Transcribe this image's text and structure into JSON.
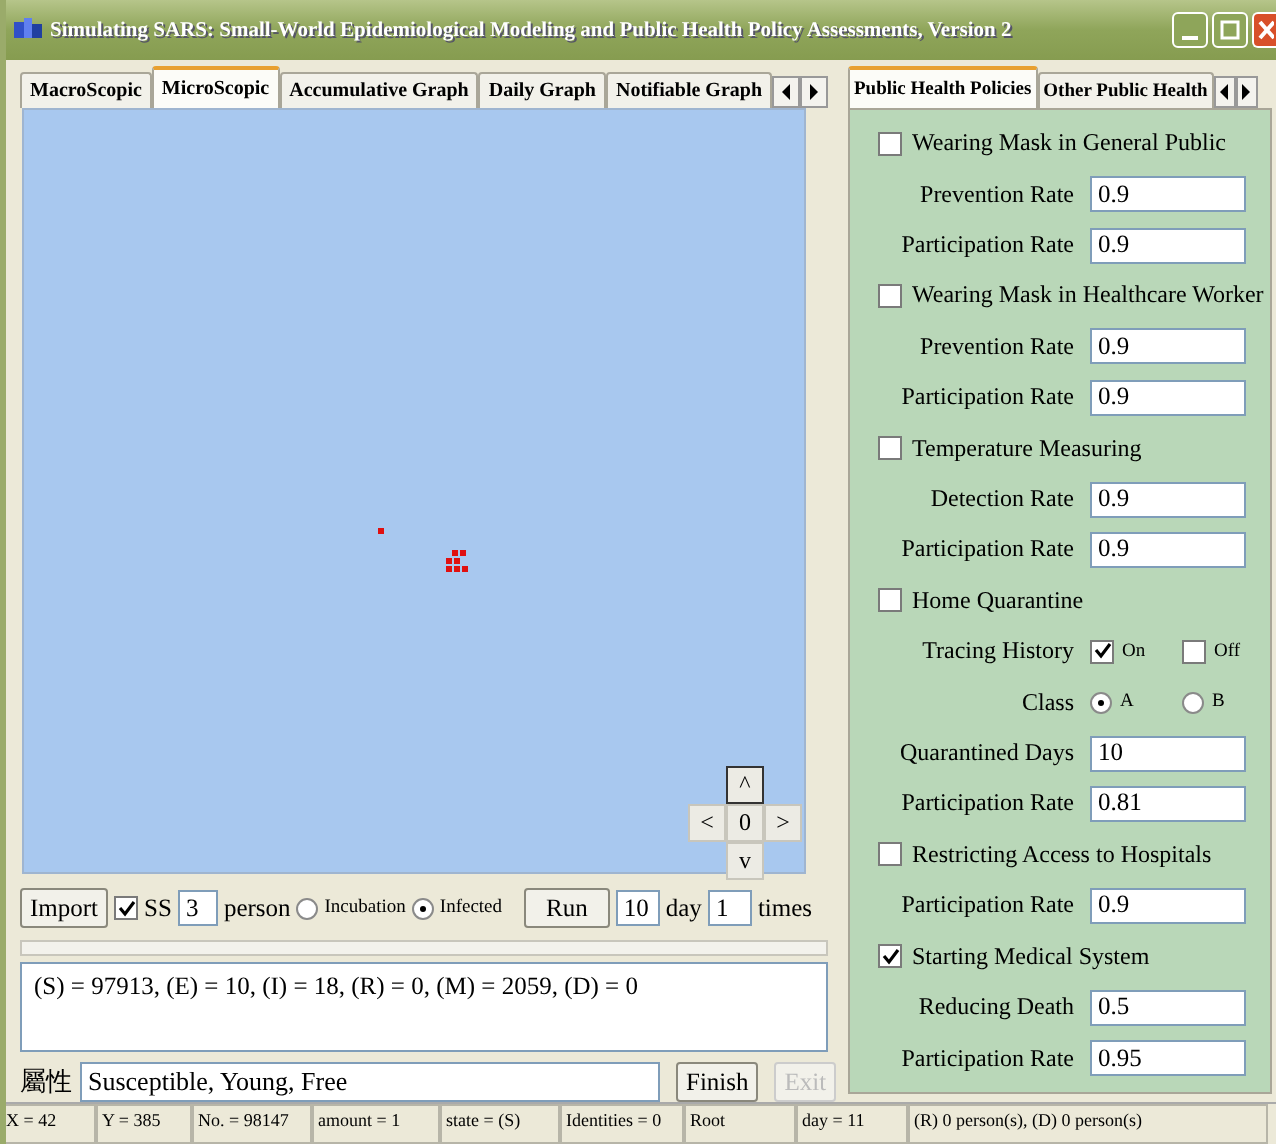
{
  "window": {
    "title": "Simulating SARS: Small-World Epidemiological Modeling and Public Health Policy Assessments, Version 2"
  },
  "left_tabs": [
    {
      "label": "MacroScopic",
      "selected": false
    },
    {
      "label": "MicroScopic",
      "selected": true
    },
    {
      "label": "Accumulative Graph",
      "selected": false
    },
    {
      "label": "Daily Graph",
      "selected": false
    },
    {
      "label": "Notifiable Graph",
      "selected": false
    }
  ],
  "navigator": {
    "up": "^",
    "left": "<",
    "center": "0",
    "right": ">",
    "down": "v"
  },
  "controls": {
    "import": "Import",
    "ss_label": "SS",
    "ss_checked": true,
    "count": "3",
    "person": "person",
    "modes": [
      {
        "label": "Incubation",
        "selected": false
      },
      {
        "label": "Infected",
        "selected": true
      }
    ],
    "run": "Run",
    "days": "10",
    "day": "day",
    "times_value": "1",
    "times": "times"
  },
  "summary": "(S) = 97913, (E) = 10, (I) = 18, (R) = 0, (M) = 2059, (D) = 0",
  "attributes": {
    "label": "屬性",
    "value": "Susceptible, Young, Free",
    "finish": "Finish",
    "exit": "Exit",
    "exit_disabled": true
  },
  "right_tabs": [
    {
      "label": "Public Health Policies",
      "selected": true
    },
    {
      "label": "Other Public Health",
      "selected": false
    }
  ],
  "policies": [
    {
      "kind": "check",
      "label": "Wearing Mask in General Public",
      "checked": false
    },
    {
      "kind": "field",
      "label": "Prevention Rate",
      "value": "0.9"
    },
    {
      "kind": "field",
      "label": "Participation Rate",
      "value": "0.9"
    },
    {
      "kind": "check",
      "label": "Wearing Mask in Healthcare Worker",
      "checked": false
    },
    {
      "kind": "field",
      "label": "Prevention Rate",
      "value": "0.9"
    },
    {
      "kind": "field",
      "label": "Participation Rate",
      "value": "0.9"
    },
    {
      "kind": "check",
      "label": "Temperature Measuring",
      "checked": false
    },
    {
      "kind": "field",
      "label": "Detection Rate",
      "value": "0.9"
    },
    {
      "kind": "field",
      "label": "Participation Rate",
      "value": "0.9"
    },
    {
      "kind": "check",
      "label": "Home Quarantine",
      "checked": false
    },
    {
      "kind": "checks",
      "label": "Tracing History",
      "options": [
        {
          "label": "On",
          "checked": true
        },
        {
          "label": "Off",
          "checked": false
        }
      ]
    },
    {
      "kind": "radios",
      "label": "Class",
      "options": [
        {
          "label": "A",
          "selected": true
        },
        {
          "label": "B",
          "selected": false
        }
      ]
    },
    {
      "kind": "field",
      "label": "Quarantined Days",
      "value": "10"
    },
    {
      "kind": "field",
      "label": "Participation Rate",
      "value": "0.81"
    },
    {
      "kind": "check",
      "label": "Restricting Access to Hospitals",
      "checked": false
    },
    {
      "kind": "field",
      "label": "Participation Rate",
      "value": "0.9"
    },
    {
      "kind": "check",
      "label": "Starting Medical System",
      "checked": true
    },
    {
      "kind": "field",
      "label": "Reducing Death",
      "value": "0.5"
    },
    {
      "kind": "field",
      "label": "Participation Rate",
      "value": "0.95"
    }
  ],
  "status_bar": [
    "X = 42",
    "Y = 385",
    "No. = 98147",
    "amount = 1",
    "state = (S)",
    "Identities = 0",
    "Root",
    "day = 11",
    "(R) 0 person(s), (D) 0 person(s)"
  ]
}
